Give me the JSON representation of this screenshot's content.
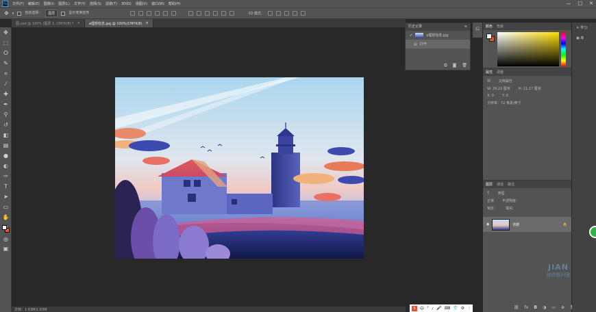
{
  "menubar": {
    "logo": "Ps",
    "items": [
      "文件(F)",
      "编辑(E)",
      "图像(I)",
      "图层(L)",
      "文字(Y)",
      "选择(S)",
      "滤镜(T)",
      "3D(D)",
      "视图(V)",
      "窗口(W)",
      "帮助(H)"
    ],
    "window_controls": [
      "—",
      "□",
      "✕"
    ]
  },
  "options": {
    "auto_select_label": "自动选择：",
    "auto_select_value": "图层",
    "show_transform_label": "显示变换控件"
  },
  "tabs": [
    {
      "label": "图.psd @ 100% (图层 1, CMYK/8) *",
      "close": "×"
    },
    {
      "label": "a理想信念.jpg @ 100%(CMYK/8)",
      "close": "×"
    }
  ],
  "history": {
    "title": "历史记录",
    "snapshot": "a理想信念.jpg",
    "steps": [
      "打开"
    ],
    "foot_icons": [
      "snapshot-icon",
      "camera-icon",
      "trash-icon"
    ]
  },
  "color_panel": {
    "tabs": [
      "颜色",
      "色板"
    ],
    "foreground": "#ffffff",
    "background": "#e25a1c"
  },
  "properties": {
    "tabs": [
      "属性",
      "调整"
    ],
    "title": "文档属性",
    "w_label": "W:",
    "w_value": "29.22 厘米",
    "h_label": "H:",
    "h_value": "21.17 厘米",
    "x_label": "X:",
    "x_value": "0",
    "y_label": "Y:",
    "y_value": "0",
    "resolution": "分辨率：72 像素/英寸"
  },
  "layers": {
    "tabs": [
      "图层",
      "通道",
      "路径"
    ],
    "kind_label": "类型",
    "mode": "正常",
    "opacity_label": "不透明度：",
    "lock_label": "锁定：",
    "fill_label": "填充：",
    "layer_name": "背景"
  },
  "statusbar": {
    "text": "文档：1.63M/1.63M"
  },
  "learn": {
    "items": [
      "学习",
      "库"
    ]
  },
  "watermark": {
    "line1": "JIAN",
    "line2": "就改智问答"
  },
  "ime": {
    "logo": "S",
    "items": [
      "中",
      "°",
      "ﾉ",
      "🎤",
      "⌨",
      "👕",
      "⚙",
      "⋮"
    ]
  },
  "accent_colors": {
    "bg_swatch": "#e25a1c",
    "ui_gray": "#535353",
    "canvas_bg": "#282828"
  }
}
